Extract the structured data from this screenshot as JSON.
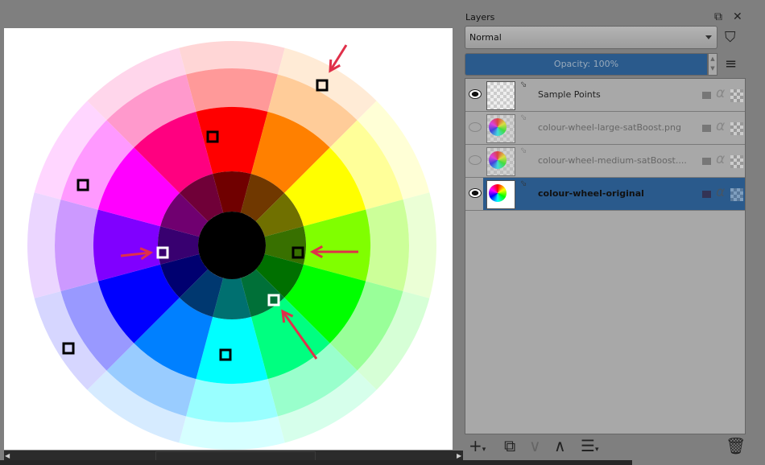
{
  "panel": {
    "title": "Layers",
    "blend_mode": "Normal",
    "opacity_label": "Opacity:  100%"
  },
  "layers": [
    {
      "name": "Sample Points",
      "visible": true,
      "selected": false
    },
    {
      "name": "colour-wheel-large-satBoost.png",
      "visible": false,
      "selected": false
    },
    {
      "name": "colour-wheel-medium-satBoost....",
      "visible": false,
      "selected": false
    },
    {
      "name": "colour-wheel-original",
      "visible": true,
      "selected": true
    }
  ],
  "colors": {
    "accent": "#2a5a8c",
    "arrow": "#e0304a"
  }
}
